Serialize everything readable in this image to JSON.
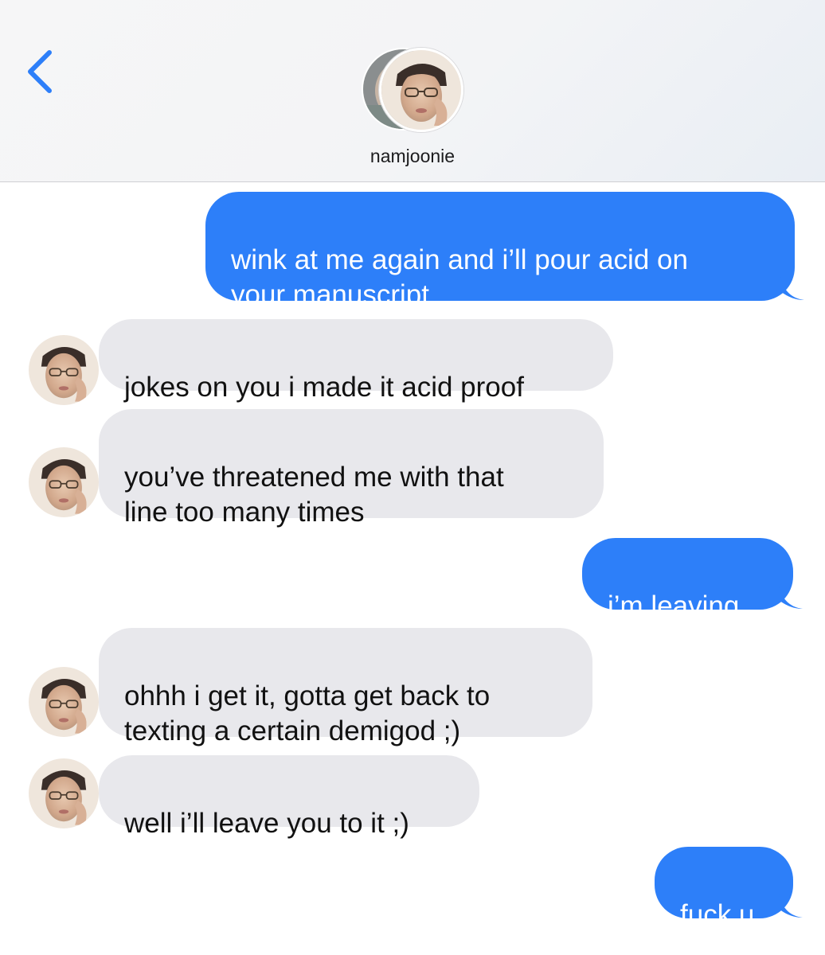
{
  "header": {
    "back_icon": "chevron-left-icon",
    "contact_name": "namjoonie",
    "accent_color": "#2d7ff9"
  },
  "messages": [
    {
      "direction": "sent",
      "text": "wink at me again and i’ll pour acid on\nyour manuscript"
    },
    {
      "direction": "received",
      "text": "jokes on you i made it acid proof"
    },
    {
      "direction": "received",
      "text": "you’ve threatened me with that\nline too many times"
    },
    {
      "direction": "sent",
      "text": "i’m leaving"
    },
    {
      "direction": "received",
      "text": "ohhh i get it, gotta get back to\ntexting a certain demigod ;)"
    },
    {
      "direction": "received",
      "text": "well i’ll leave you to it ;)"
    },
    {
      "direction": "sent",
      "text": "fuck u"
    }
  ],
  "colors": {
    "sent_bubble": "#2d7ff9",
    "received_bubble": "#e8e8ec"
  }
}
